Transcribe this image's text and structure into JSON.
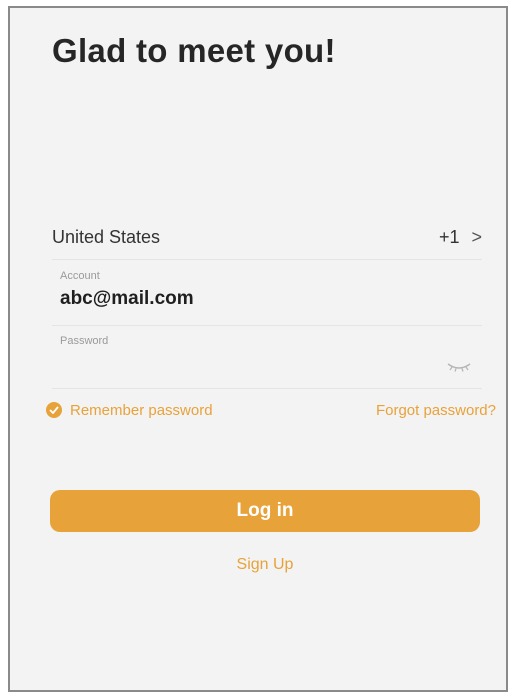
{
  "header": {
    "title": "Glad to meet you!"
  },
  "region": {
    "country": "United States",
    "dial_code": "+1",
    "chevron": ">",
    "icon": "chevron-right-icon"
  },
  "account": {
    "label": "Account",
    "value": "abc@mail.com"
  },
  "password": {
    "label": "Password",
    "value": "",
    "toggle_icon": "eye-closed-icon"
  },
  "options": {
    "remember_label": "Remember password",
    "remember_checked": true,
    "forgot_label": "Forgot password?"
  },
  "actions": {
    "login_label": "Log in",
    "signup_label": "Sign Up"
  },
  "colors": {
    "accent": "#e8a23a",
    "background": "#f3f3f3",
    "title_text": "#262626"
  }
}
